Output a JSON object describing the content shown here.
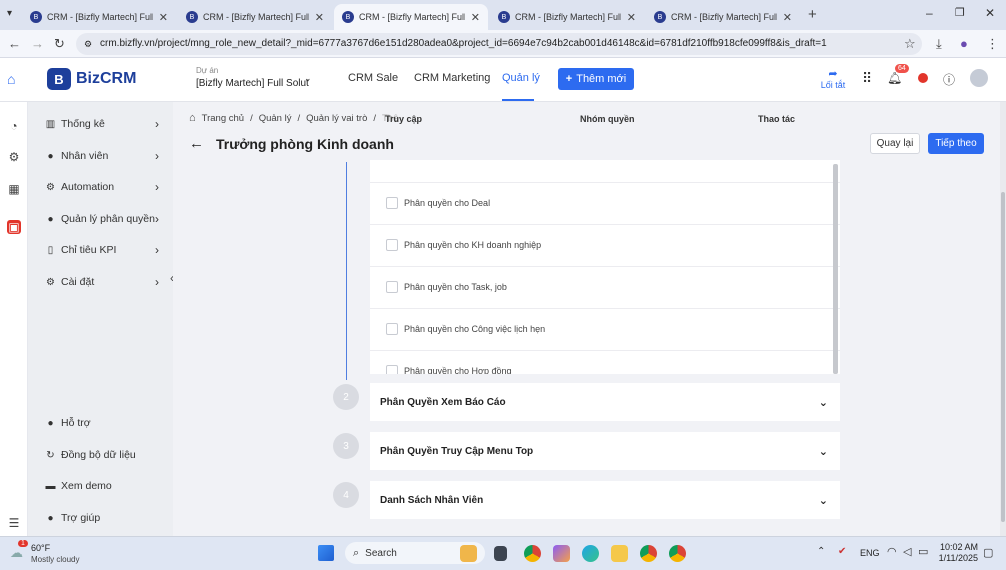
{
  "browser": {
    "tabs": [
      {
        "title": "CRM - [Bizfly Martech] Full Solu"
      },
      {
        "title": "CRM - [Bizfly Martech] Full Solu"
      },
      {
        "title": "CRM - [Bizfly Martech] Full Solu"
      },
      {
        "title": "CRM - [Bizfly Martech] Full Solu"
      },
      {
        "title": "CRM - [Bizfly Martech] Full Solu"
      }
    ],
    "url": "crm.bizfly.vn/project/mng_role_new_detail?_mid=6777a3767d6e151d280adea0&project_id=6694e7c94b2cab001d46148c&id=6781df210ffb918cfe099ff8&is_draft=1"
  },
  "header": {
    "logo_mark": "B",
    "logo_text": "BizCRM",
    "project_label": "Dự án",
    "project_value": "[Bizfly Martech] Full Solut",
    "nav": [
      "CRM Sale",
      "CRM Marketing",
      "Quản lý"
    ],
    "add_button": "Thêm mới",
    "shortcut_label": "Lối tắt",
    "notification_count": "64"
  },
  "sidebar": {
    "items": [
      {
        "label": "Thống kê",
        "icon": "chart-icon"
      },
      {
        "label": "Nhân viên",
        "icon": "user-icon"
      },
      {
        "label": "Automation",
        "icon": "automation-icon"
      },
      {
        "label": "Quản lý phân quyền",
        "icon": "permission-icon"
      },
      {
        "label": "Chỉ tiêu KPI",
        "icon": "kpi-icon"
      },
      {
        "label": "Cài đặt",
        "icon": "gear-icon"
      }
    ],
    "bottom": [
      {
        "label": "Hỗ trợ"
      },
      {
        "label": "Đồng bộ dữ liệu"
      },
      {
        "label": "Xem demo"
      },
      {
        "label": "Trợ giúp"
      }
    ]
  },
  "main": {
    "breadcrumb": [
      "Trang chủ",
      "Quản lý",
      "Quản lý vai trò",
      "Thê"
    ],
    "title": "Trưởng phòng Kinh doanh",
    "columns": [
      "Truy cập",
      "Nhóm quyền",
      "Thao tác"
    ],
    "back_button": "Quay lại",
    "next_button": "Tiếp theo",
    "permissions": [
      "Phân quyền cho Deal",
      "Phân quyền cho KH doanh nghiệp",
      "Phân quyền cho Task, job",
      "Phân quyền cho Công việc lịch hẹn",
      "Phân quyền cho Hợp đồng"
    ],
    "sections": [
      {
        "step": "2",
        "title": "Phân Quyền Xem Báo Cáo"
      },
      {
        "step": "3",
        "title": "Phân Quyền Truy Cập Menu Top"
      },
      {
        "step": "4",
        "title": "Danh Sách Nhân Viên"
      }
    ]
  },
  "taskbar": {
    "weather_temp": "60°F",
    "weather_desc": "Mostly cloudy",
    "weather_badge": "1",
    "search_label": "Search",
    "lang": "ENG",
    "time": "10:02 AM",
    "date": "1/11/2025"
  }
}
